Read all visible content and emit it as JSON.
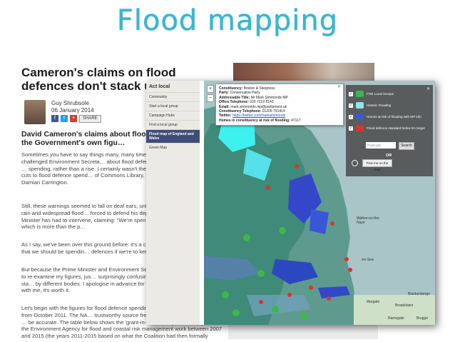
{
  "slide": {
    "title": "Flood mapping"
  },
  "article": {
    "headline": "Cameron's claims on flood defences don't stack up",
    "author": "Guy Shrubsole",
    "date": "06 January 2014",
    "share_label": "SHARE",
    "lead": "David Cameron's claims about flood defe… borne out by the Government's own figu…",
    "p1": "Sometimes you have to say things many, many times f… Back in October, I challenged Environment Secreta… about flood defence spending, arguing that he was … spending, rather than a rise. I certainly wasn't the first … highlighted the Coalition's cuts to flood defence spend… of Commons Library, the Committee on Climate Cha… Damian Carrington.",
    "p2": "Still, these warnings seemed to fall on deaf ears, until t… Britain battered by torrential rain and widespread flood… forced to defend his department's policies. Most sign… Minister has had to intervene, claiming: \"We're spen… year period on flood defences, which is more than the p…",
    "p3": "As I say, we've been over this ground before: it's a clai… moreover, it fails to mention that we should be spendin… defences if we're to keep pace with climate change.",
    "p4": "But because the Prime Minister and Environment Secre… by this claim, I felt obliged to re-examine my figures, jus… surprisingly confusing subject, with multiple sets of sta… by different bodies. I apologise in advance for the dense… that follow, but bear with me, it's worth it.",
    "p5": "Let's begin with the figures for flood defence spending … Office (NAO) in a report from October 2011. The NA… trustworthy source free from political axes to grind, so … be accurate. The table below shows the 'grant-in-aid' funding Defra has given to the Environment Agency for flood and coastal risk management work between 2007 and 2015 (the years 2011-2015 based on what the Coalition had then formally announced"
  },
  "nav": {
    "title": "Act local",
    "items": [
      {
        "label": "Community"
      },
      {
        "label": "Start a local group"
      },
      {
        "label": "Campaign Hubs"
      },
      {
        "label": "Find a local group"
      },
      {
        "label": "Flood map of England and Wales"
      },
      {
        "label": "Green Map"
      }
    ]
  },
  "popup": {
    "constituency_label": "Constituency:",
    "constituency": "Boston & Skegness",
    "party_label": "Party:",
    "party": "Conservative Party",
    "title_label": "Addressable Title:",
    "title": "Mr Mark Simmonds MP",
    "office_label": "Office Telephone:",
    "office": "020 7219 8143",
    "email_label": "Email:",
    "email": "mark.simmonds.mp@parliament.uk",
    "ctel_label": "Constituency Telephone:",
    "ctel": "01205 751414",
    "twitter_label": "Twitter:",
    "twitter": "https://twitter.com/marksimmonds",
    "homes_label": "Homes in constituency at risk of flooding:",
    "homes": "47117"
  },
  "legend": {
    "items": [
      {
        "label": "FOE Local Groups",
        "color": "#3cb84a"
      },
      {
        "label": "Historic Flooding",
        "color": "#8fe3ee"
      },
      {
        "label": "Homes at risk of flooding with MP info",
        "color": "#3a59d6"
      },
      {
        "label": "Flood defence standard below EA target",
        "color": "#e03030"
      }
    ],
    "postcode_placeholder": "Postcode",
    "search_label": "Search",
    "or_label": "OR",
    "find_label": "Find me on the map"
  },
  "map_labels": {
    "walton": "Walton-on-the-\nNaze",
    "southend": "-on-Sea",
    "margate": "Margate",
    "broadstairs": "Broadstairs",
    "ramsgate": "Ramsgate",
    "blankenberge": "Blankenberge",
    "brugge": "Brugge"
  }
}
